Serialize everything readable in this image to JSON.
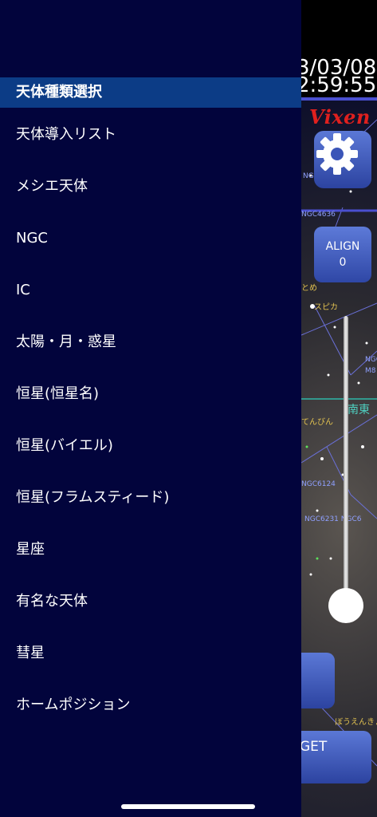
{
  "status": {
    "date": "3/03/08",
    "time": "2:59:55"
  },
  "brand": "Vixen",
  "controls": {
    "align_label": "ALIGN",
    "align_count": "0",
    "target_label": "GET"
  },
  "sky_labels": {
    "spica": "スピカ",
    "otome": "とめ",
    "tenbin": "てんびん",
    "south_east": "南東",
    "ngc4636": "NGC4636",
    "ngc46": "NGC46",
    "ngc6124": "NGC6124",
    "ngc_pair": "NGC6231 NGC6",
    "m8": "M8",
    "ngc5": "NGC5",
    "houenkyo": "ぼうえんきょう"
  },
  "drawer": {
    "header": "天体種類選択",
    "items": [
      "天体導入リスト",
      "メシエ天体",
      "NGC",
      "IC",
      "太陽・月・惑星",
      "恒星(恒星名)",
      "恒星(バイエル)",
      "恒星(フラムスティード)",
      "星座",
      "有名な天体",
      "彗星",
      "ホームポジション"
    ]
  },
  "colors": {
    "drawer_bg": "#02043c",
    "header_bg": "#0c3c86",
    "button_blue": "#3b55b8",
    "brand_red": "#e0201e"
  }
}
